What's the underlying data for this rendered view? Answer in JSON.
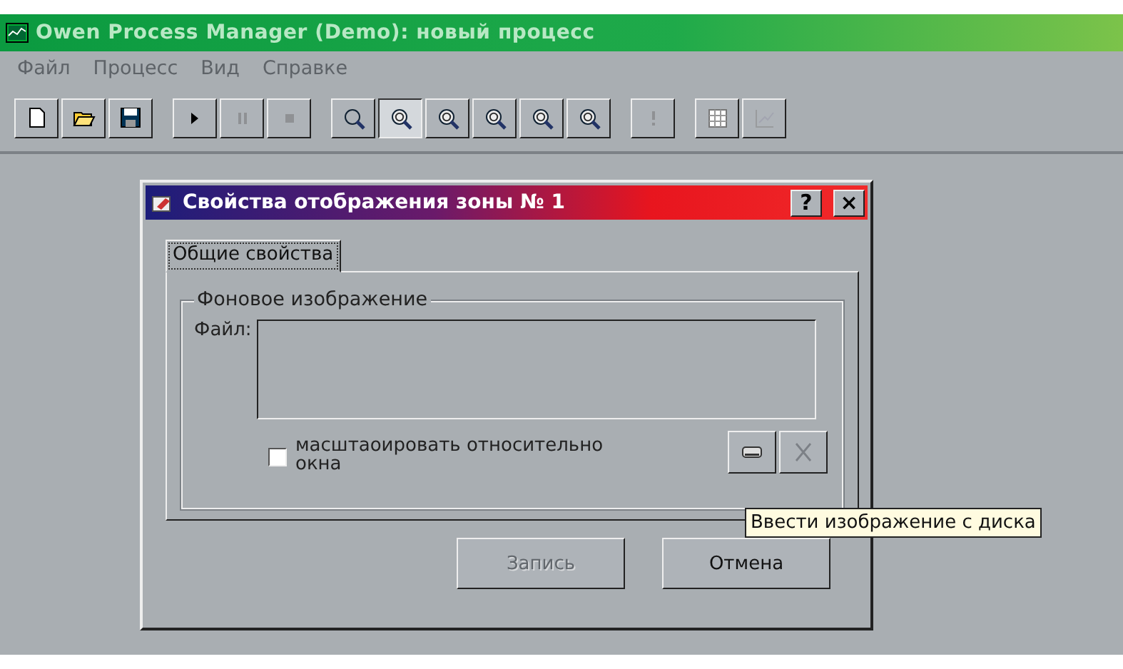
{
  "window": {
    "title": "Owen Process Manager (Demo): новый процесс"
  },
  "menu": [
    {
      "label": "Файл"
    },
    {
      "label": "Процесс"
    },
    {
      "label": "Вид"
    },
    {
      "label": "Справке"
    }
  ],
  "toolbar": [
    [
      {
        "kind": "new",
        "pressed": false,
        "disabled": false
      },
      {
        "kind": "open",
        "pressed": false,
        "disabled": false
      },
      {
        "kind": "save",
        "pressed": false,
        "disabled": false
      }
    ],
    [
      {
        "kind": "play",
        "pressed": false,
        "disabled": false
      },
      {
        "kind": "pause",
        "pressed": false,
        "disabled": true
      },
      {
        "kind": "stop",
        "pressed": false,
        "disabled": true
      }
    ],
    [
      {
        "kind": "zoom",
        "pressed": false,
        "disabled": false
      },
      {
        "kind": "zoom-1",
        "pressed": true,
        "disabled": false
      },
      {
        "kind": "zoom-2",
        "pressed": false,
        "disabled": false
      },
      {
        "kind": "zoom-3",
        "pressed": false,
        "disabled": false
      },
      {
        "kind": "zoom-4",
        "pressed": false,
        "disabled": false
      },
      {
        "kind": "zoom-5",
        "pressed": false,
        "disabled": false
      }
    ],
    [
      {
        "kind": "alert",
        "pressed": false,
        "disabled": true
      }
    ],
    [
      {
        "kind": "table",
        "pressed": false,
        "disabled": false
      },
      {
        "kind": "chart",
        "pressed": false,
        "disabled": true
      }
    ]
  ],
  "dialog": {
    "title": "Свойства отображения зоны № 1",
    "help": "?",
    "close": "×",
    "tabs": [
      {
        "label": "Общие свойства",
        "selected": true
      }
    ],
    "group": {
      "title": "Фоновое изображение",
      "file_label": "Файл:",
      "scale_checkbox": {
        "label": "масштаоировать относительно окна",
        "checked": false
      }
    },
    "tooltip": "Ввести изображение с диска",
    "buttons": [
      {
        "label": "Запись",
        "disabled": true
      },
      {
        "label": "Отмена",
        "disabled": false
      }
    ]
  }
}
